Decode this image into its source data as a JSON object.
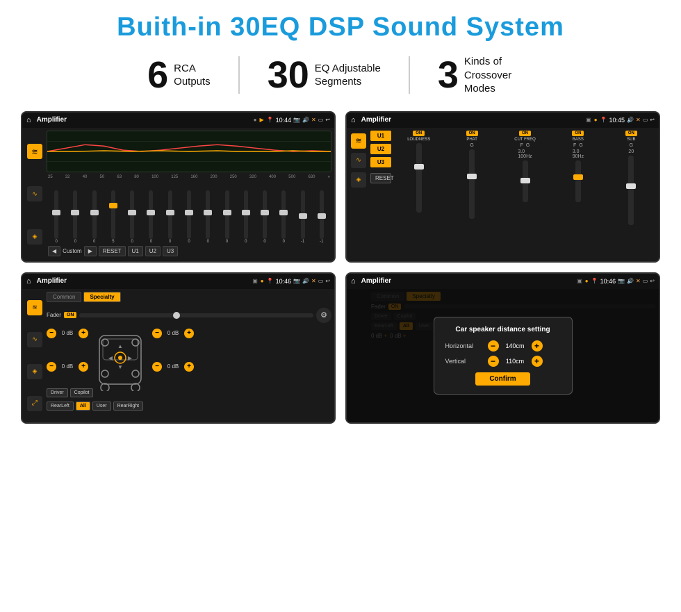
{
  "page": {
    "title": "Buith-in 30EQ DSP Sound System",
    "background": "#ffffff"
  },
  "stats": [
    {
      "number": "6",
      "label": "RCA\nOutputs"
    },
    {
      "number": "30",
      "label": "EQ Adjustable\nSegments"
    },
    {
      "number": "3",
      "label": "Kinds of\nCrossover Modes"
    }
  ],
  "screens": {
    "eq": {
      "title": "Amplifier",
      "time": "10:44",
      "preset": "Custom",
      "freq_labels": [
        "25",
        "32",
        "40",
        "50",
        "63",
        "80",
        "100",
        "125",
        "160",
        "200",
        "250",
        "320",
        "400",
        "500",
        "630"
      ],
      "slider_values": [
        "0",
        "0",
        "0",
        "5",
        "0",
        "0",
        "0",
        "0",
        "0",
        "0",
        "0",
        "0",
        "0",
        "-1",
        "0",
        "-1"
      ],
      "buttons": [
        "◀",
        "Custom",
        "▶",
        "RESET",
        "U1",
        "U2",
        "U3"
      ]
    },
    "mixer": {
      "title": "Amplifier",
      "time": "10:45",
      "presets": [
        "U1",
        "U2",
        "U3"
      ],
      "channels": [
        {
          "on": true,
          "label": "LOUDNESS"
        },
        {
          "on": true,
          "label": "PHAT"
        },
        {
          "on": true,
          "label": "CUT FREQ"
        },
        {
          "on": true,
          "label": "BASS"
        },
        {
          "on": true,
          "label": "SUB"
        }
      ],
      "reset_label": "RESET"
    },
    "speaker": {
      "title": "Amplifier",
      "time": "10:46",
      "tabs": [
        "Common",
        "Specialty"
      ],
      "active_tab": "Specialty",
      "fader_label": "Fader",
      "fader_on": true,
      "channels": [
        {
          "value": "0 dB"
        },
        {
          "value": "0 dB"
        },
        {
          "value": "0 dB"
        },
        {
          "value": "0 dB"
        }
      ],
      "bottom_btns": [
        "Driver",
        "RearLeft",
        "All",
        "User",
        "RearRight",
        "Copilot"
      ]
    },
    "dialog": {
      "title": "Amplifier",
      "time": "10:46",
      "dialog_title": "Car speaker distance setting",
      "horizontal_label": "Horizontal",
      "horizontal_value": "140cm",
      "vertical_label": "Vertical",
      "vertical_value": "110cm",
      "confirm_label": "Confirm",
      "bottom_btns": [
        "Driver",
        "RearLeft",
        "All",
        "User",
        "RearRight",
        "Copilot"
      ]
    }
  },
  "icons": {
    "home": "⌂",
    "menu": "☰",
    "play": "▶",
    "pause": "⏸",
    "eq_icon": "≋",
    "wave_icon": "∿",
    "speaker_icon": "🔊",
    "location": "📍",
    "camera": "📷",
    "volume": "🔊",
    "close": "✕",
    "window": "▭",
    "back": "↩"
  }
}
